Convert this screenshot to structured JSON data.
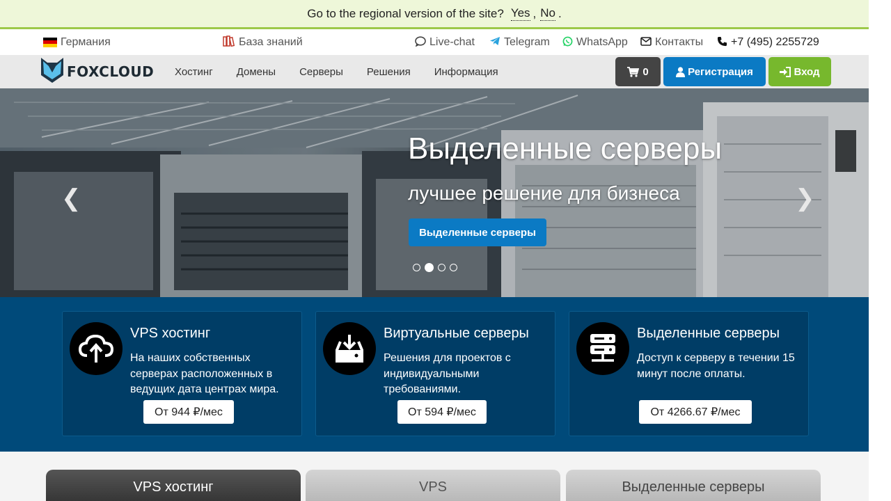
{
  "region_banner": {
    "question": "Go to the regional version of the site?",
    "yes": "Yes",
    "separator": ",",
    "no": "No",
    "end": "."
  },
  "topbar": {
    "country": "Германия",
    "knowledge_base": "База знаний",
    "live_chat": "Live-chat",
    "telegram": "Telegram",
    "whatsapp": "WhatsApp",
    "contacts": "Контакты",
    "phone": "+7 (495) 2255729"
  },
  "nav": {
    "logo": "FOXCLOUD",
    "menu": [
      "Хостинг",
      "Домены",
      "Серверы",
      "Решения",
      "Информация"
    ],
    "cart_count": "0",
    "register": "Регистрация",
    "login": "Вход"
  },
  "hero": {
    "title": "Выделенные серверы",
    "subtitle": "лучшее решение для бизнеса",
    "button": "Выделенные серверы",
    "slide_count": 4,
    "active_slide": 2
  },
  "features": [
    {
      "title": "VPS хостинг",
      "description": "На наших собственных серверах расположенных в ведущих дата центрах мира.",
      "price": "От 944 ₽/мес",
      "icon": "cloud-upload-icon"
    },
    {
      "title": "Виртуальные серверы",
      "description": "Решения для проектов с индивидуальными требованиями.",
      "price": "От 594 ₽/мес",
      "icon": "drive-download-icon"
    },
    {
      "title": "Выделенные серверы",
      "description": "Доступ к серверу в течении 15 минут после оплаты.",
      "price": "От 4266.67 ₽/мес",
      "icon": "server-icon"
    }
  ],
  "tabs": [
    "VPS хостинг",
    "VPS",
    "Выделенные серверы"
  ],
  "colors": {
    "banner_bg": "#eef7d9",
    "banner_border": "#9dc94a",
    "primary_blue": "#0b7ac4",
    "login_green": "#77b82d",
    "cart_dark": "#444444",
    "features_bg": "#004a7a",
    "card_bg": "#003d66"
  }
}
